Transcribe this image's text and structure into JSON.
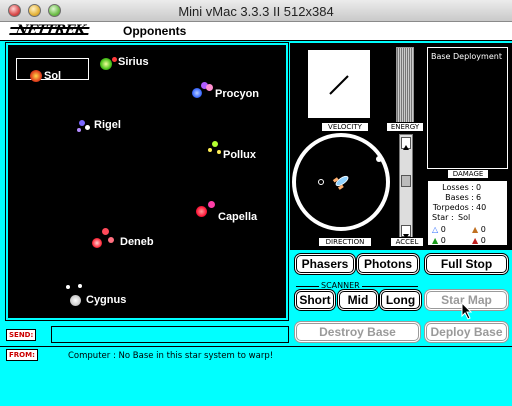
{
  "window": {
    "title": "Mini vMac 3.3.3 II 512x384"
  },
  "menubar": {
    "logo": "NETTREK",
    "menus": [
      "Opponents"
    ]
  },
  "starmap": {
    "stars": [
      {
        "name": "Sol",
        "selected": true
      },
      {
        "name": "Sirius"
      },
      {
        "name": "Procyon"
      },
      {
        "name": "Rigel"
      },
      {
        "name": "Pollux"
      },
      {
        "name": "Capella"
      },
      {
        "name": "Deneb"
      },
      {
        "name": "Cygnus"
      }
    ]
  },
  "instruments": {
    "velocity_label": "VELOCITY",
    "energy_label": "ENERGY",
    "direction_label": "DIRECTION",
    "accel_label": "ACCEL",
    "damage_label": "DAMAGE",
    "base_deployment_title": "Base Deployment"
  },
  "stats": {
    "losses_label": "Losses :",
    "losses": "0",
    "bases_label": "Bases :",
    "bases": "6",
    "torpedos_label": "Torpedos :",
    "torpedos": "40",
    "star_label": "Star :",
    "star": "Sol",
    "counts": [
      "0",
      "0",
      "0",
      "0"
    ]
  },
  "buttons": {
    "phasers": "Phasers",
    "photons": "Photons",
    "full_stop": "Full Stop",
    "scanner_label": "SCANNER",
    "short": "Short",
    "mid": "Mid",
    "long": "Long",
    "star_map": "Star Map",
    "destroy_base": "Destroy Base",
    "deploy_base": "Deploy Base"
  },
  "comm": {
    "send_tag": "SEND:",
    "send_value": "",
    "from_tag": "FROM:",
    "message": "Computer : No Base in this star system to warp!"
  },
  "colors": {
    "background": "#00ffff",
    "space": "#000000"
  }
}
